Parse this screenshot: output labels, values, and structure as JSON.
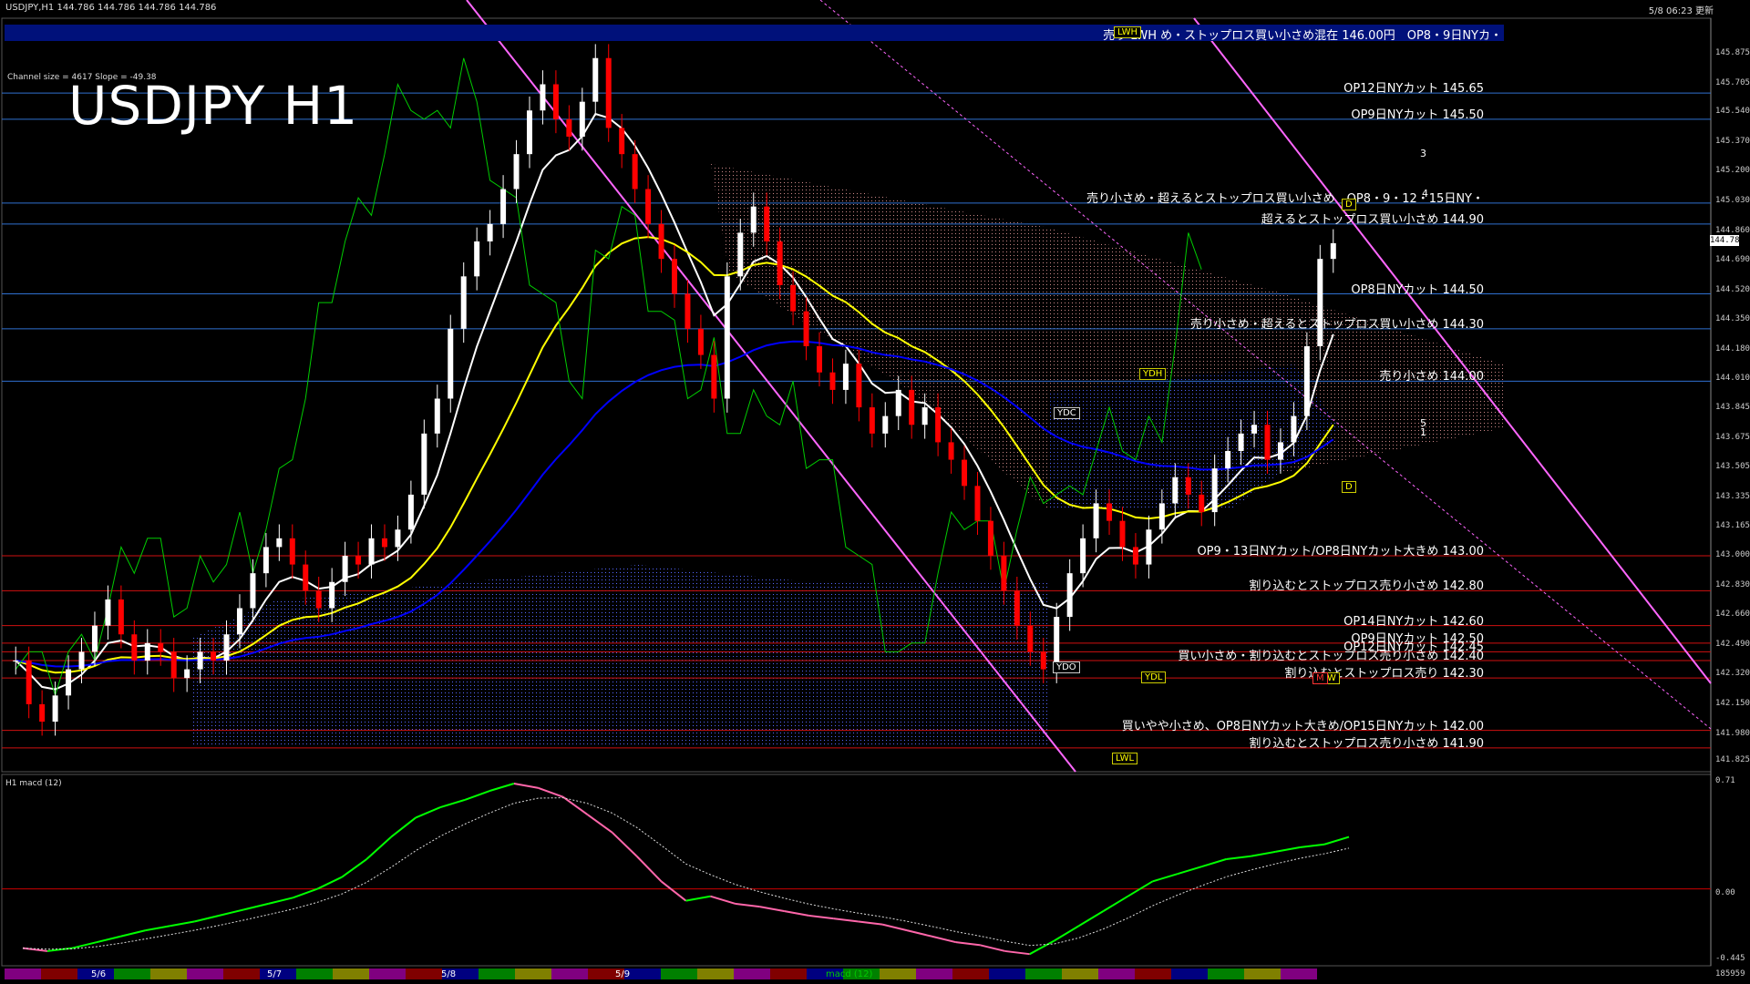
{
  "header": {
    "symbol_info": "USDJPY,H1  144.786 144.786 144.786 144.786",
    "datetime": "5/8 06:23 更新"
  },
  "title": "USDJPY H1",
  "channel_info": "Channel size = 4617 Slope = -49.38",
  "current_price": "144.786",
  "banner_text": "売り LWH め・ストップロス買い小さめ混在 146.00円　OP8・9日NYカ・",
  "macd_title": "H1  macd (12)",
  "colors": {
    "background": "#000000",
    "bull_candle": "#ffffff",
    "bear_candle": "#ff0000",
    "ema_fast": "#ffffff",
    "ema_mid": "#ffff00",
    "ema_slow": "#0000ff",
    "lagging_span": "#00cc00",
    "channel": "#ff66ff",
    "macd_up": "#00ff00",
    "macd_down": "#ff66aa"
  },
  "level_labels": [
    {
      "text": "OP12日NYカット 145.65",
      "price": 145.65
    },
    {
      "text": "OP9日NYカット 145.50",
      "price": 145.5
    },
    {
      "text": "売り小さめ・超えるとストップロス買い小さめ　OP8・9・12・15日NY・",
      "price": 145.02
    },
    {
      "text": "超えるとストップロス買い小さめ 144.90",
      "price": 144.9
    },
    {
      "text": "OP8日NYカット 144.50",
      "price": 144.5
    },
    {
      "text": "売り小さめ・超えるとストップロス買い小さめ 144.30",
      "price": 144.3
    },
    {
      "text": "売り小さめ 144.00",
      "price": 144.0
    },
    {
      "text": "OP9・13日NYカット/OP8日NYカット大きめ 143.00",
      "price": 143.0
    },
    {
      "text": "割り込むとストップロス売り小さめ 142.80",
      "price": 142.8
    },
    {
      "text": "OP14日NYカット 142.60",
      "price": 142.6
    },
    {
      "text": "OP9日NYカット 142.50",
      "price": 142.5
    },
    {
      "text": "OP12日NYカット 142.45",
      "price": 142.45
    },
    {
      "text": "買い小さめ・割り込むとストップロス売り小さめ 142.40",
      "price": 142.4
    },
    {
      "text": "割り込むとストップロス売り 142.30",
      "price": 142.3
    },
    {
      "text": "買いやや小さめ、OP8日NYカット大きめ/OP15日NYカット 142.00",
      "price": 142.0
    },
    {
      "text": "割り込むとストップロス売り小さめ 141.90",
      "price": 141.9
    }
  ],
  "price_axis": [
    "145.875",
    "145.705",
    "145.540",
    "145.370",
    "145.200",
    "145.030",
    "144.860",
    "144.690",
    "144.520",
    "144.350",
    "144.180",
    "144.010",
    "143.845",
    "143.675",
    "143.505",
    "143.335",
    "143.165",
    "143.000",
    "142.830",
    "142.660",
    "142.490",
    "142.320",
    "142.150",
    "141.980",
    "141.825"
  ],
  "macd_axis": [
    "0.71",
    "0.00",
    "-0.445"
  ],
  "date_labels": [
    "5/6",
    "5/7",
    "5/8",
    "5/9"
  ],
  "boxes": {
    "ydc": "YDC",
    "ydo": "YDO",
    "ydh": "YDH",
    "ydl": "YDL",
    "lwl": "LWL",
    "lwh": "LWH",
    "d1": "D",
    "d2": "D",
    "w": "W",
    "m": "M"
  },
  "wave_labels": [
    "3",
    "4",
    "5",
    "1"
  ],
  "footer_right": "185959",
  "footer_tag": "macd (12)",
  "chart_data": {
    "type": "candlestick",
    "title": "USDJPY H1",
    "ylim": [
      141.8,
      146.0
    ],
    "macd_ylim": [
      -0.445,
      0.71
    ],
    "series": [
      {
        "name": "close",
        "values": [
          142.4,
          142.15,
          142.05,
          142.2,
          142.35,
          142.45,
          142.6,
          142.75,
          142.55,
          142.4,
          142.5,
          142.45,
          142.3,
          142.35,
          142.45,
          142.4,
          142.55,
          142.7,
          142.9,
          143.05,
          143.1,
          142.95,
          142.8,
          142.7,
          142.85,
          143.0,
          142.95,
          143.1,
          143.05,
          143.15,
          143.35,
          143.7,
          143.9,
          144.3,
          144.6,
          144.8,
          144.9,
          145.1,
          145.3,
          145.55,
          145.7,
          145.5,
          145.4,
          145.6,
          145.85,
          145.45,
          145.3,
          145.1,
          144.9,
          144.7,
          144.5,
          144.3,
          144.15,
          143.9,
          144.6,
          144.85,
          145.0,
          144.8,
          144.55,
          144.4,
          144.2,
          144.05,
          143.95,
          144.1,
          143.85,
          143.7,
          143.8,
          143.95,
          143.75,
          143.85,
          143.65,
          143.55,
          143.4,
          143.2,
          143.0,
          142.8,
          142.6,
          142.45,
          142.35,
          142.65,
          142.9,
          143.1,
          143.3,
          143.2,
          143.05,
          142.95,
          143.15,
          143.3,
          143.45,
          143.35,
          143.25,
          143.5,
          143.6,
          143.7,
          143.75,
          143.55,
          143.65,
          143.8,
          144.2,
          144.7,
          144.79
        ]
      }
    ],
    "macd": [
      -0.4,
      -0.42,
      -0.4,
      -0.36,
      -0.32,
      -0.28,
      -0.25,
      -0.22,
      -0.18,
      -0.14,
      -0.1,
      -0.06,
      0.0,
      0.08,
      0.2,
      0.35,
      0.48,
      0.55,
      0.6,
      0.66,
      0.71,
      0.68,
      0.62,
      0.5,
      0.38,
      0.22,
      0.05,
      -0.08,
      -0.05,
      -0.1,
      -0.12,
      -0.15,
      -0.18,
      -0.2,
      -0.22,
      -0.24,
      -0.28,
      -0.32,
      -0.36,
      -0.38,
      -0.42,
      -0.44,
      -0.35,
      -0.25,
      -0.15,
      -0.05,
      0.05,
      0.1,
      0.15,
      0.2,
      0.22,
      0.25,
      0.28,
      0.3,
      0.35
    ]
  }
}
